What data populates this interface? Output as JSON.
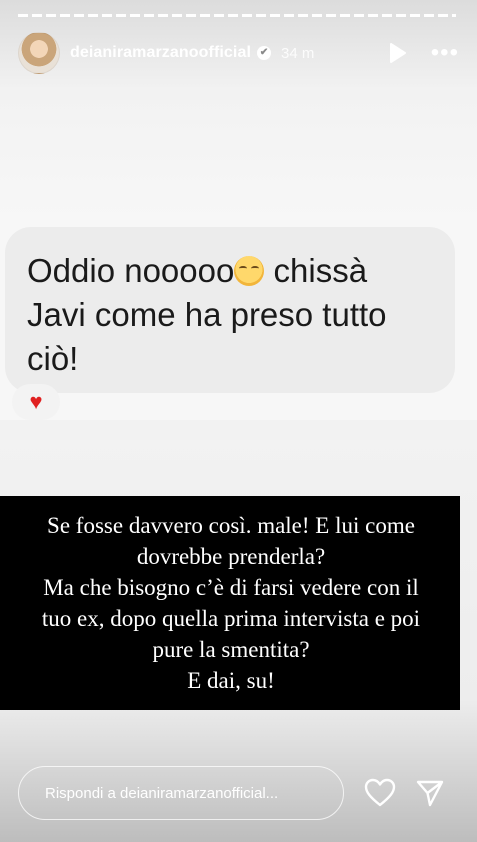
{
  "header": {
    "username": "deianiramarzanoofficial",
    "verified_mark": "✔",
    "time": "34 m",
    "play_icon": "play-icon",
    "more_label": "•••"
  },
  "message": {
    "line1_prefix": "Oddio nooooo",
    "line1_suffix": " chissà",
    "line2": "Javi come ha preso tutto",
    "line3": "ciò!",
    "emoji": "pensive-face-emoji",
    "reaction": "♥"
  },
  "caption": {
    "line1": "Se fosse davvero così. male! E lui come",
    "line2": "dovrebbe prenderla?",
    "line3": "Ma che bisogno c’è di farsi vedere con il",
    "line4": "tuo ex, dopo quella prima intervista e poi",
    "line5": "pure la smentita?",
    "line6": "E dai, su!"
  },
  "footer": {
    "reply_placeholder": "Rispondi a deianiramarzanofficial...",
    "like_icon": "heart-outline-icon",
    "share_icon": "send-icon"
  },
  "colors": {
    "caption_bg": "#000000",
    "heart": "#e02020"
  }
}
